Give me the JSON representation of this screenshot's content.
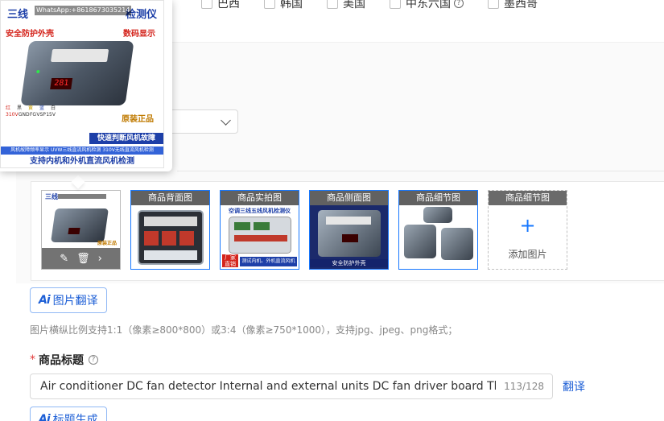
{
  "countries": [
    {
      "label": "巴西"
    },
    {
      "label": "韩国"
    },
    {
      "label": "美国"
    },
    {
      "label": "中东六国"
    },
    {
      "label": "墨西哥"
    }
  ],
  "preview": {
    "title_left": "三线",
    "title_right": "检测仪",
    "whatsapp": "WhatsApp:+8618673035214",
    "feature_left": "安全防护外壳",
    "feature_right": "数码显示",
    "display_value": "281",
    "legend": [
      "红",
      "黑",
      "黄",
      "蓝",
      "白"
    ],
    "legend_sub": [
      "310V",
      "GND",
      "FG",
      "VSP",
      "15V"
    ],
    "original": "原装正品",
    "band": "快速判断风机故障",
    "band2": "风机故障频率显示 UVW三线直流风机检测 310V无线直流风机检测",
    "footer": "支持内机和外机直流风机检测"
  },
  "thumbnails": [
    {
      "label": "",
      "ops": {
        "edit": "✎",
        "delete": "🗑",
        "more": "›"
      }
    },
    {
      "label": "商品背面图"
    },
    {
      "label": "商品实拍图",
      "caption": "空调三线五线风机检测仪",
      "tag": "厂家直销",
      "tag2": "测试内机、外机直流风机"
    },
    {
      "label": "商品侧面图",
      "caption": "安全防护外壳"
    },
    {
      "label": "商品细节图"
    }
  ],
  "add_image": {
    "label": "商品细节图",
    "plus": "+",
    "text": "添加图片"
  },
  "image_translate_btn": {
    "ai": "Ai",
    "label": "图片翻译"
  },
  "hint": "图片横纵比例支持1:1（像素≥800*800）或3:4（像素≥750*1000），支持jpg、jpeg、png格式；",
  "product_title": {
    "required": "*",
    "label": "商品标题",
    "value": "Air conditioner DC fan detector Internal and external units DC fan driver board Three-wire five-wire",
    "counter": "113/128",
    "translate": "翻译"
  },
  "title_gen_btn": {
    "ai": "Ai",
    "label": "标题生成"
  },
  "colors": {
    "accent": "#1677ff",
    "brand_blue": "#1d3fa8",
    "required": "#e23b3b"
  }
}
